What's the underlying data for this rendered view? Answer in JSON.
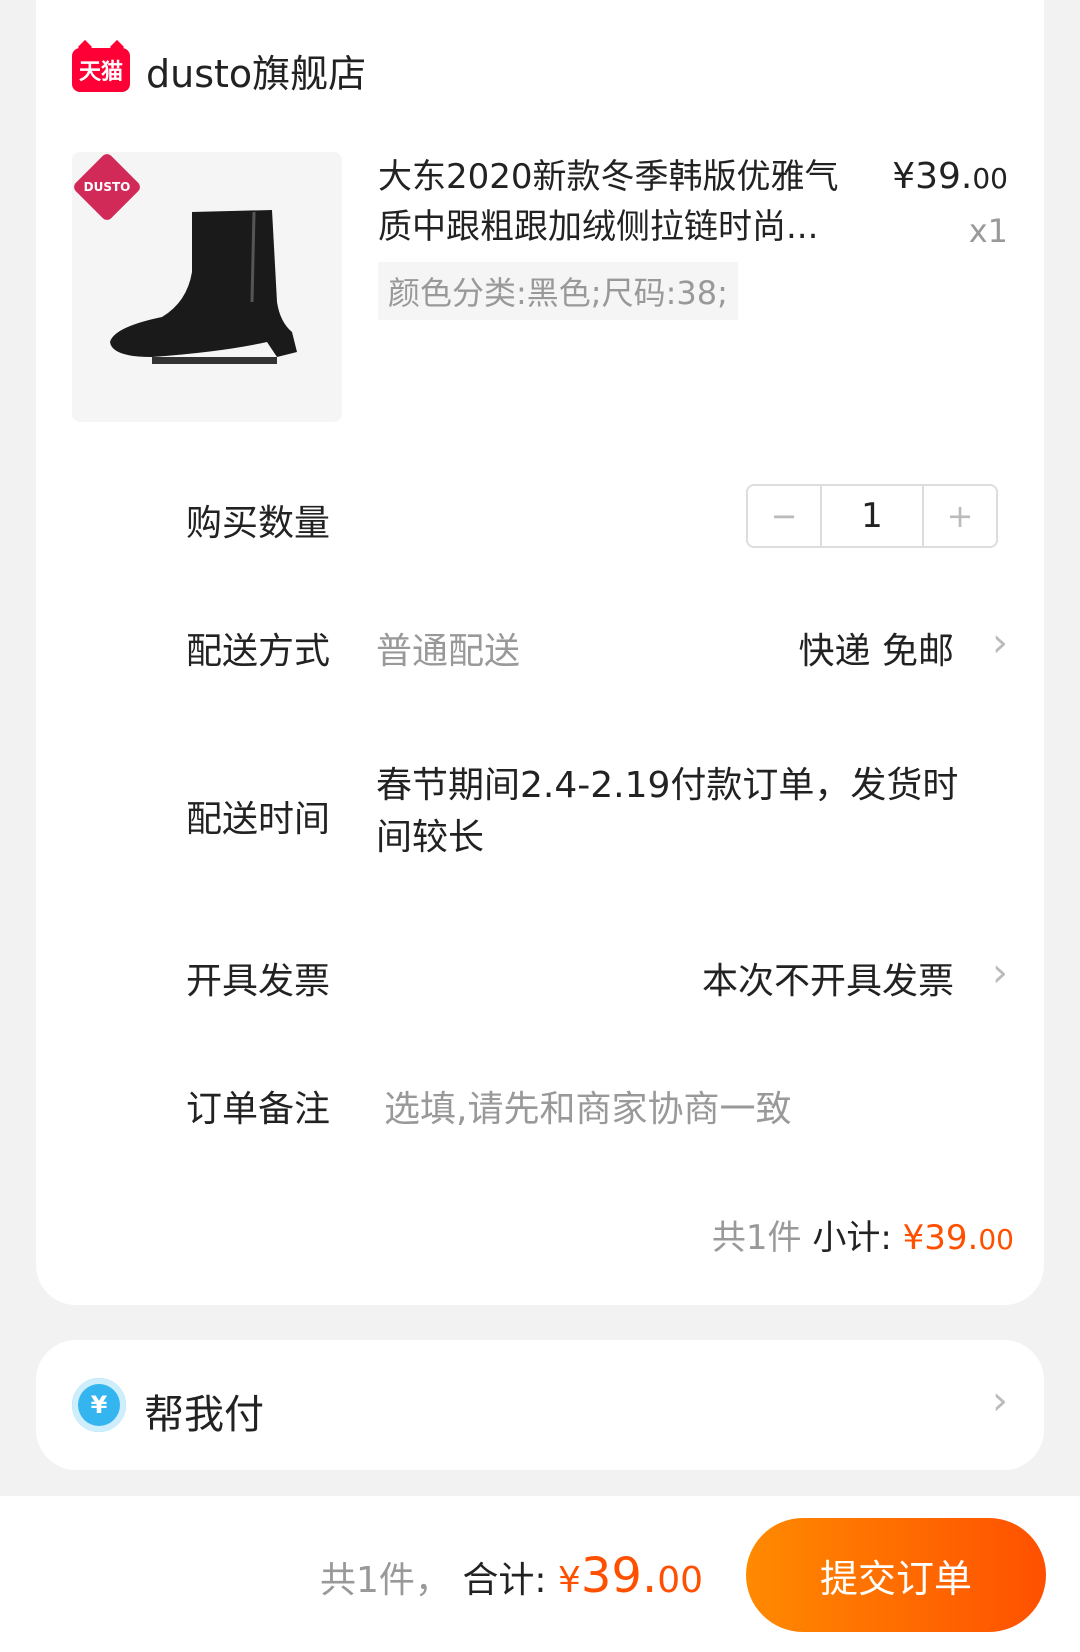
{
  "store": {
    "badge": "天猫",
    "name": "dusto旗舰店"
  },
  "product": {
    "brand_badge": "DUSTO",
    "title": "大东2020新款冬季韩版优雅气质中跟粗跟加绒侧拉链时尚...",
    "price_main": "¥39.",
    "price_cents": "00",
    "qty": "x1",
    "sku": "颜色分类:黑色;尺码:38;"
  },
  "quantity": {
    "label": "购买数量",
    "minus": "−",
    "value": "1",
    "plus": "+"
  },
  "shipping": {
    "label": "配送方式",
    "method": "普通配送",
    "detail": "快递 免邮"
  },
  "delivery_time": {
    "label": "配送时间",
    "text": "春节期间2.4-2.19付款订单，发货时间较长"
  },
  "invoice": {
    "label": "开具发票",
    "value": "本次不开具发票"
  },
  "note": {
    "label": "订单备注",
    "placeholder": "选填,请先和商家协商一致"
  },
  "subtotal": {
    "count": "共1件",
    "label": "小计:",
    "price_main": "¥39.",
    "price_cents": "00"
  },
  "help_pay": {
    "icon_text": "¥",
    "label": "帮我付"
  },
  "footer": {
    "count": "共1件，",
    "label": "合计:",
    "price_yen": "¥",
    "price_main": "39.",
    "price_cents": "00",
    "submit": "提交订单"
  },
  "colors": {
    "accent": "#ff5000",
    "tmall": "#ff0036"
  },
  "icons": {
    "chevron": "chevron-right-icon",
    "pay": "yen-circle-icon"
  }
}
